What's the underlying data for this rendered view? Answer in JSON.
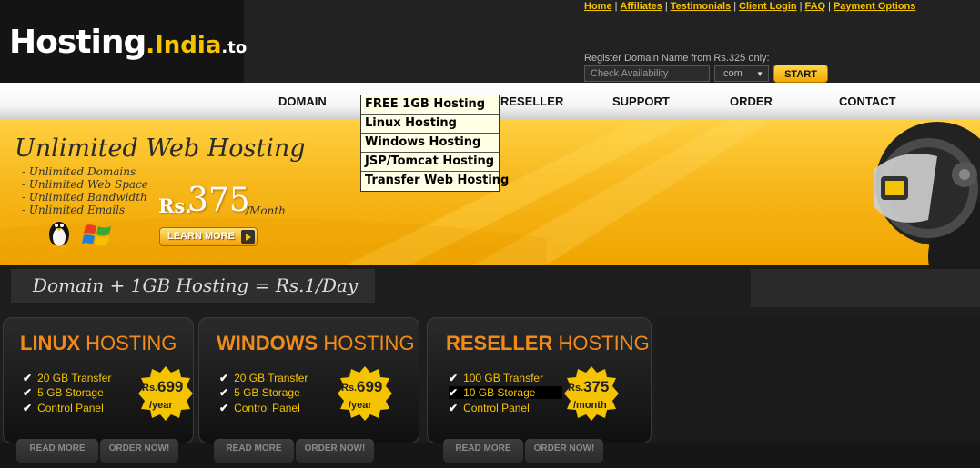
{
  "logo": {
    "part1": "Hosting",
    "part2": ".India",
    "part3": ".to"
  },
  "toplinks": [
    "Home",
    "Affiliates",
    "Testimonials",
    "Client Login",
    "FAQ",
    "Payment Options"
  ],
  "domain_search": {
    "label": "Register Domain Name from Rs.325 only:",
    "placeholder": "Check Availability",
    "tld": ".com",
    "button": "START"
  },
  "nav": {
    "items": [
      "DOMAIN",
      "RESELLER",
      "SUPPORT",
      "ORDER",
      "CONTACT"
    ]
  },
  "dropdown": [
    "FREE 1GB Hosting",
    "Linux Hosting",
    "Windows Hosting",
    "JSP/Tomcat Hosting",
    "Transfer Web Hosting"
  ],
  "banner": {
    "title": "Unlimited Web Hosting",
    "bullets": [
      "- Unlimited Domains",
      "- Unlimited Web Space",
      "- Unlimited Bandwidth",
      "- Unlimited Emails"
    ],
    "price_rs": "Rs.",
    "price": "375",
    "price_per": "/Month",
    "learn_more": "LEARN MORE"
  },
  "strip": {
    "text": "Domain + 1GB Hosting = Rs.1/Day"
  },
  "plans": [
    {
      "title1": "LINUX",
      "title2": "HOSTING",
      "features": [
        "20 GB Transfer",
        "5 GB Storage",
        "Control Panel"
      ],
      "rs": "Rs.",
      "price": "699",
      "per": "/year",
      "read_more": "READ MORE",
      "order_now": "ORDER NOW!"
    },
    {
      "title1": "WINDOWS",
      "title2": "HOSTING",
      "features": [
        "20 GB Transfer",
        "5 GB Storage",
        "Control Panel"
      ],
      "rs": "Rs.",
      "price": "699",
      "per": "/year",
      "read_more": "READ MORE",
      "order_now": "ORDER NOW!"
    },
    {
      "title1": "RESELLER",
      "title2": "HOSTING",
      "features": [
        "100 GB Transfer",
        "10 GB Storage",
        "Control Panel"
      ],
      "rs": "Rs.",
      "price": "375",
      "per": "/month",
      "read_more": "READ MORE",
      "order_now": "ORDER NOW!"
    }
  ],
  "colors": {
    "accent": "#f5c400",
    "orange": "#f28a1a",
    "background": "#1d1d1d"
  }
}
